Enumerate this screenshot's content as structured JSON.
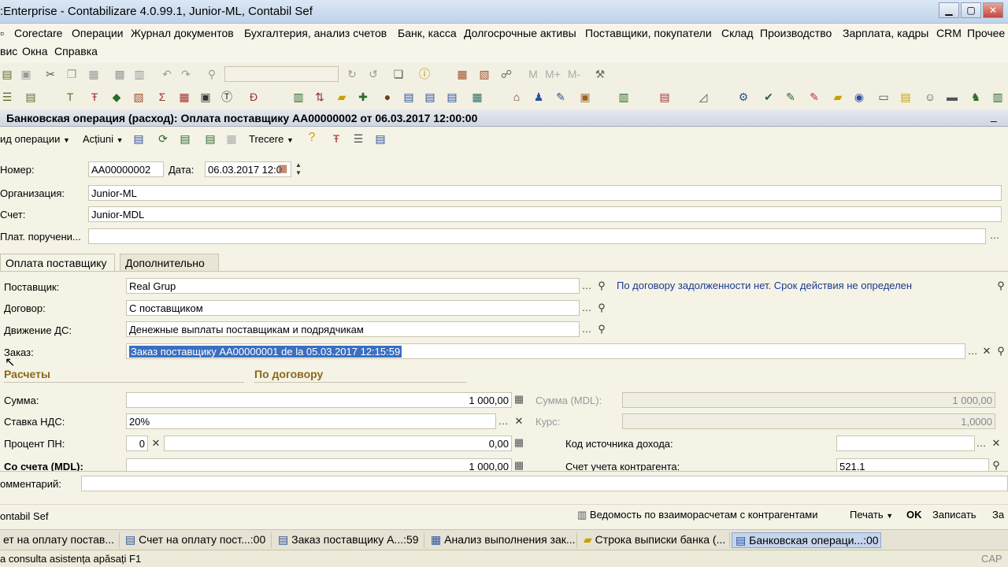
{
  "window": {
    "title": ":Enterprise - Contabilizare 4.0.99.1, Junior-ML, Contabil Sef"
  },
  "menu": {
    "row1": [
      "Corectare",
      "Операции",
      "Журнал документов",
      "Бухгалтерия, анализ счетов",
      "Банк, касса",
      "Долгосрочные активы",
      "Поставщики, покупатели",
      "Склад",
      "Производство",
      "Зарплата, кадры",
      "CRM",
      "Прочее"
    ],
    "row2": [
      "вис",
      "Окна",
      "Справка"
    ]
  },
  "document": {
    "title": "Банковская операция (расход): Оплата поставщику АА00000002 от 06.03.2017 12:00:00",
    "actions": {
      "op_type": "ид операции",
      "actiuni": "Acțiuni",
      "trecere": "Trecere"
    },
    "fields": {
      "nomer_label": "Номер:",
      "nomer": "АА00000002",
      "data_label": "Дата:",
      "data": "06.03.2017 12:0",
      "org_label": "Организация:",
      "org": "Junior-ML",
      "schet_label": "Счет:",
      "schet": "Junior-MDL",
      "plat_label": "Плат. поручени...",
      "plat": ""
    },
    "tabs": [
      "Оплата поставщику",
      "Дополнительно"
    ],
    "supplier": {
      "postavshik_label": "Поставщик:",
      "postavshik": "Real Grup",
      "dogovor_label": "Договор:",
      "dogovor": "С поставщиком",
      "dvizhenie_label": "Движение ДС:",
      "dvizhenie": "Денежные выплаты поставщикам и подрядчикам",
      "zakaz_label": "Заказ:",
      "zakaz": "Заказ поставщику АА00000001 de la 05.03.2017 12:15:59",
      "info": "По договору задолженности нет. Срок действия не определен"
    },
    "sections": {
      "raschety": "Расчеты",
      "po_dogovoru": "По договору"
    },
    "calc": {
      "summa_label": "Сумма:",
      "summa": "1 000,00",
      "nds_label": "Ставка НДС:",
      "nds": "20%",
      "pn_label": "Процент ПН:",
      "pn": "0",
      "pn_sum": "0,00",
      "so_scheta_label": "Со счета (MDL):",
      "so_scheta": "1 000,00",
      "summa_mdl_label": "Сумма (MDL):",
      "summa_mdl": "1 000,00",
      "kurs_label": "Курс:",
      "kurs": "1,0000",
      "kod_label": "Код источника дохода:",
      "kod": "",
      "schet_kontr_label": "Счет учета контрагента:",
      "schet_kontr": "521.1"
    },
    "comment_label": "омментарий:",
    "footer": {
      "left": "ontabil Sef",
      "vedomost": "Ведомость по взаиморасчетам с контрагентами",
      "pechat": "Печать",
      "ok": "OK",
      "zapisat": "Записать",
      "za": "За"
    }
  },
  "taskbar": [
    "ет на оплату постав...",
    "Счет на оплату пост...:00",
    "Заказ поставщику А...:59",
    "Анализ выполнения зак...",
    "Строка выписки банка (...",
    "Банковская операци...:00"
  ],
  "status": {
    "text": "a consulta asistența apăsați F1",
    "caps": "CAP"
  }
}
